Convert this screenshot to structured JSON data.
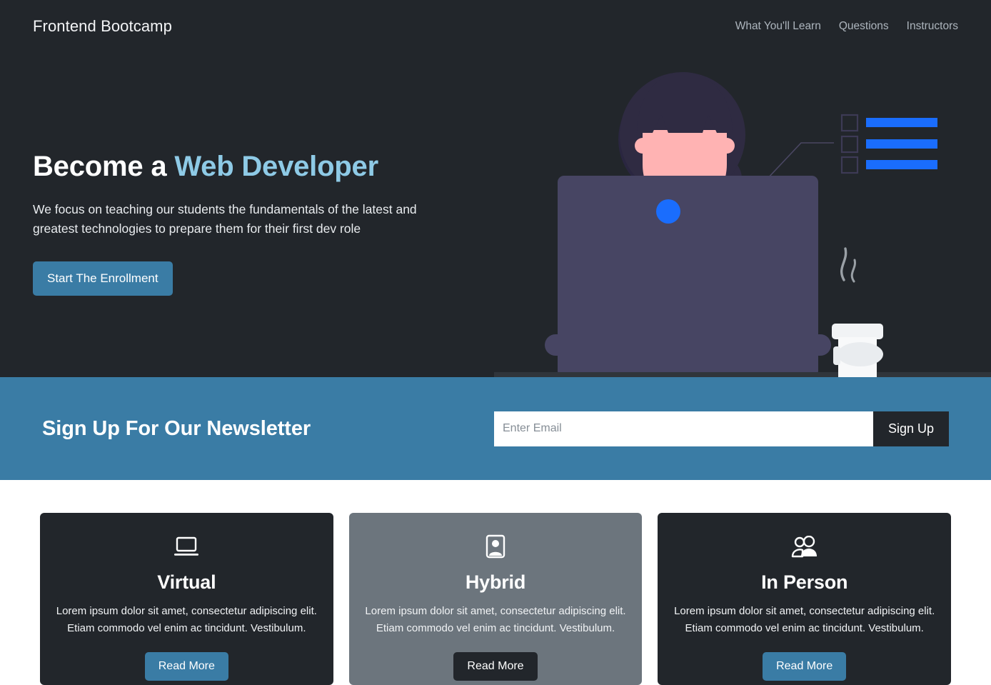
{
  "navbar": {
    "brand": "Frontend Bootcamp",
    "links": [
      {
        "label": "What You'll Learn"
      },
      {
        "label": "Questions"
      },
      {
        "label": "Instructors"
      }
    ]
  },
  "hero": {
    "title_lead": "Become a ",
    "title_accent": "Web Developer",
    "subtitle": "We focus on teaching our students the fundamentals of the latest and greatest technologies to prepare them for their first dev role",
    "cta_label": "Start The Enrollment",
    "illustration": {
      "name": "woman-at-laptop-with-checklist",
      "background": "#22262b",
      "hair_color": "#2f2b42",
      "skin_color": "#ffb3b3",
      "shirt_color": "#ced4da",
      "strap_color": "#2f2b42",
      "laptop_color": "#474563",
      "laptop_dot_color": "#1a6dfd",
      "checklist_bar_color": "#1a6dfd",
      "checkbox_border_color": "#3d3a55",
      "cup_color": "#f1f3f5",
      "connector_line_color": "#4a4763",
      "checklist_rows": 3
    }
  },
  "newsletter": {
    "title": "Sign Up For Our Newsletter",
    "email_value": "",
    "email_placeholder": "Enter Email",
    "submit_label": "Sign Up",
    "background": "#3a7ca5"
  },
  "cards": [
    {
      "icon": "laptop-icon",
      "title": "Virtual",
      "text": "Lorem ipsum dolor sit amet, consectetur adipiscing elit. Etiam commodo vel enim ac tincidunt. Vestibulum.",
      "button_label": "Read More",
      "theme": "dark",
      "button_theme": "blue"
    },
    {
      "icon": "person-badge-icon",
      "title": "Hybrid",
      "text": "Lorem ipsum dolor sit amet, consectetur adipiscing elit. Etiam commodo vel enim ac tincidunt. Vestibulum.",
      "button_label": "Read More",
      "theme": "gray",
      "button_theme": "dark"
    },
    {
      "icon": "people-icon",
      "title": "In Person",
      "text": "Lorem ipsum dolor sit amet, consectetur adipiscing elit. Etiam commodo vel enim ac tincidunt. Vestibulum.",
      "button_label": "Read More",
      "theme": "dark",
      "button_theme": "blue"
    }
  ],
  "colors": {
    "dark": "#22262b",
    "accent_blue": "#3a7ca5",
    "light_blue": "#8ecae6",
    "gray": "#6c757d",
    "bright_blue": "#1a6dfd"
  }
}
